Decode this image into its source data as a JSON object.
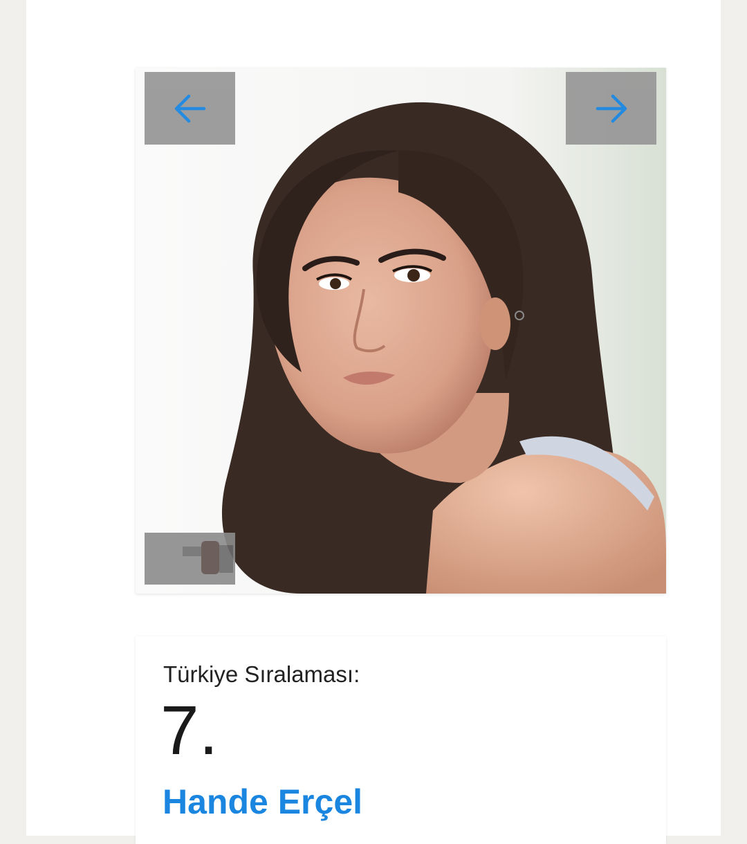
{
  "slider": {
    "prev_icon": "arrow-left-icon",
    "next_icon": "arrow-right-icon",
    "arrow_color": "#1a86e0",
    "button_bg": "#999999"
  },
  "ranking": {
    "label": "Türkiye Sıralaması:",
    "number": "7.",
    "name": "Hande Erçel",
    "name_color": "#1a86e0"
  }
}
